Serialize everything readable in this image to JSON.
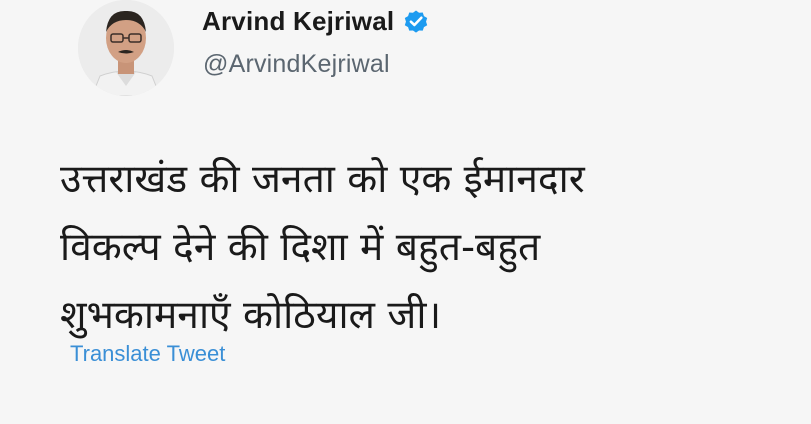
{
  "author": {
    "display_name": "Arvind Kejriwal",
    "handle": "@ArvindKejriwal",
    "verified": true,
    "verified_color": "#1d9bf0"
  },
  "tweet": {
    "lines": [
      "उत्तराखंड की जनता को एक ईमानदार",
      "विकल्प देने की दिशा में बहुत-बहुत",
      "शुभकामनाएँ कोठियाल जी।"
    ]
  },
  "actions": {
    "translate_label": "Translate Tweet",
    "link_color": "#3a8fd6"
  }
}
